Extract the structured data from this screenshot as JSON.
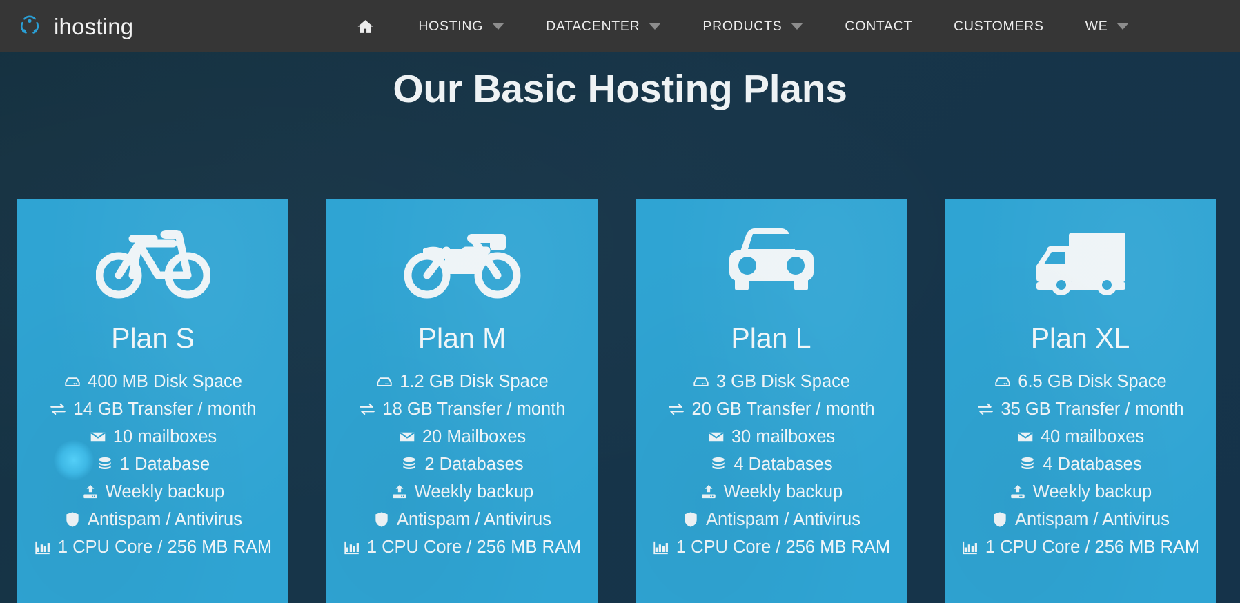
{
  "brand": {
    "name": "ihosting",
    "logo_icon": "ihosting-circles-logo",
    "accent": "#2a9fd6"
  },
  "nav": {
    "home_icon": "home-icon",
    "items": [
      {
        "label": "HOSTING",
        "has_dropdown": true
      },
      {
        "label": "DATACENTER",
        "has_dropdown": true
      },
      {
        "label": "PRODUCTS",
        "has_dropdown": true
      },
      {
        "label": "CONTACT",
        "has_dropdown": false
      },
      {
        "label": "CUSTOMERS",
        "has_dropdown": false
      },
      {
        "label": "WE",
        "has_dropdown": true
      }
    ],
    "background": "#363636"
  },
  "heading": {
    "title": "Our Basic Hosting Plans",
    "color": "#eef2f4"
  },
  "theme": {
    "page_background": "#173549",
    "card_background": "#2fa4d3",
    "card_text": "#f2f8fb"
  },
  "plans": [
    {
      "icon": "bicycle-icon",
      "name": "Plan S",
      "features": [
        {
          "icon": "hard-drive-icon",
          "text": "400 MB Disk Space"
        },
        {
          "icon": "transfer-icon",
          "text": "14 GB Transfer / month"
        },
        {
          "icon": "envelope-icon",
          "text": "10 mailboxes"
        },
        {
          "icon": "database-icon",
          "text": "1 Database"
        },
        {
          "icon": "backup-upload-icon",
          "text": "Weekly backup"
        },
        {
          "icon": "shield-icon",
          "text": "Antispam / Antivirus"
        },
        {
          "icon": "bar-chart-icon",
          "text": "1 CPU Core / 256 MB RAM"
        }
      ]
    },
    {
      "icon": "motorcycle-icon",
      "name": "Plan M",
      "features": [
        {
          "icon": "hard-drive-icon",
          "text": "1.2 GB Disk Space"
        },
        {
          "icon": "transfer-icon",
          "text": "18 GB Transfer / month"
        },
        {
          "icon": "envelope-icon",
          "text": "20 Mailboxes"
        },
        {
          "icon": "database-icon",
          "text": "2 Databases"
        },
        {
          "icon": "backup-upload-icon",
          "text": "Weekly backup"
        },
        {
          "icon": "shield-icon",
          "text": "Antispam / Antivirus"
        },
        {
          "icon": "bar-chart-icon",
          "text": "1 CPU Core / 256 MB RAM"
        }
      ]
    },
    {
      "icon": "car-icon",
      "name": "Plan L",
      "features": [
        {
          "icon": "hard-drive-icon",
          "text": "3 GB Disk Space"
        },
        {
          "icon": "transfer-icon",
          "text": "20 GB Transfer / month"
        },
        {
          "icon": "envelope-icon",
          "text": "30 mailboxes"
        },
        {
          "icon": "database-icon",
          "text": "4 Databases"
        },
        {
          "icon": "backup-upload-icon",
          "text": "Weekly backup"
        },
        {
          "icon": "shield-icon",
          "text": "Antispam / Antivirus"
        },
        {
          "icon": "bar-chart-icon",
          "text": "1 CPU Core / 256 MB RAM"
        }
      ]
    },
    {
      "icon": "truck-icon",
      "name": "Plan XL",
      "features": [
        {
          "icon": "hard-drive-icon",
          "text": "6.5 GB Disk Space"
        },
        {
          "icon": "transfer-icon",
          "text": "35 GB Transfer / month"
        },
        {
          "icon": "envelope-icon",
          "text": "40 mailboxes"
        },
        {
          "icon": "database-icon",
          "text": "4 Databases"
        },
        {
          "icon": "backup-upload-icon",
          "text": "Weekly backup"
        },
        {
          "icon": "shield-icon",
          "text": "Antispam / Antivirus"
        },
        {
          "icon": "bar-chart-icon",
          "text": "1 CPU Core / 256 MB RAM"
        }
      ]
    }
  ],
  "cursor": {
    "highlight_icon": "cursor-click-highlight",
    "color": "#4fd2fb"
  }
}
